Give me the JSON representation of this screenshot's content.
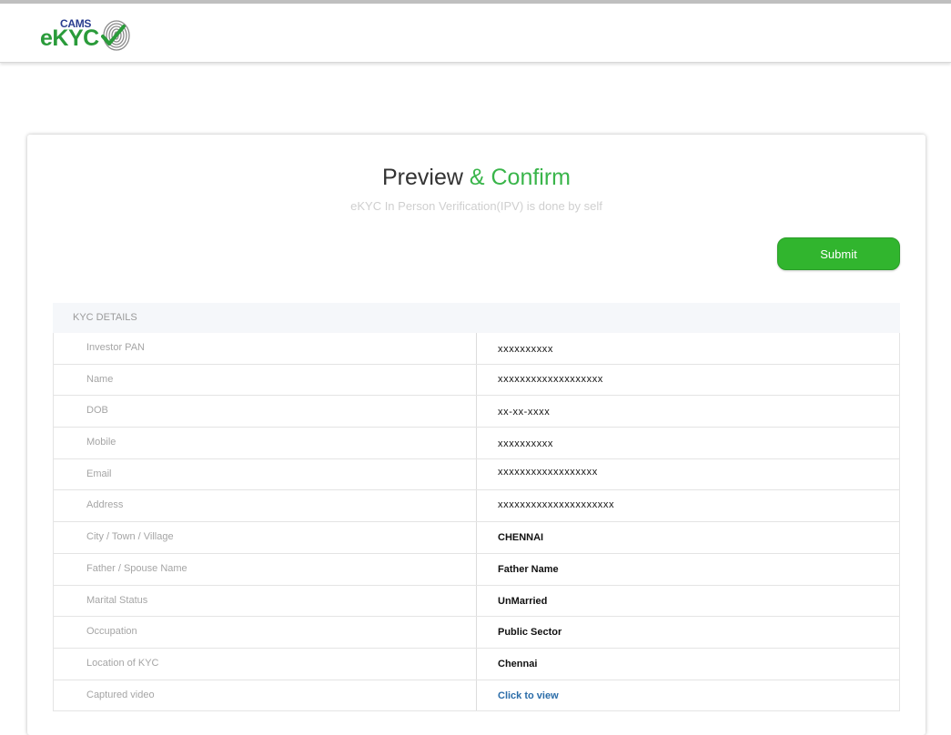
{
  "header": {
    "logo": {
      "brand_top": "CAMS",
      "brand_main": "eKYC",
      "icon": "fingerprint-check-icon"
    }
  },
  "page": {
    "title_part1": "Preview ",
    "title_part2": "& Confirm",
    "subtitle": "eKYC In Person Verification(IPV) is done by self",
    "submit_label": "Submit"
  },
  "kyc": {
    "section_title": "KYC DETAILS",
    "rows": [
      {
        "label": "Investor PAN",
        "value": "xxxxxxxxxx"
      },
      {
        "label": "Name",
        "value": "xxxxxxxxxxxxxxxxxxx"
      },
      {
        "label": "DOB",
        "value": "xx-xx-xxxx"
      },
      {
        "label": "Mobile",
        "value": "xxxxxxxxxx"
      },
      {
        "label": "Email",
        "value": "xxxxxxxxxxxxxxxxxx"
      },
      {
        "label": "Address",
        "value": "xxxxxxxxxxxxxxxxxxxxx"
      },
      {
        "label": "City / Town / Village",
        "value": "CHENNAI"
      },
      {
        "label": "Father / Spouse Name",
        "value": "Father Name"
      },
      {
        "label": "Marital Status",
        "value": "UnMarried"
      },
      {
        "label": "Occupation",
        "value": "Public Sector"
      },
      {
        "label": "Location of KYC",
        "value": "Chennai"
      },
      {
        "label": "Captured video",
        "value": "Click to view"
      }
    ]
  },
  "colors": {
    "accent_green": "#39b54a",
    "button_green": "#31b52e",
    "link_blue": "#2a6ca8",
    "brand_blue": "#2a3d8f"
  }
}
